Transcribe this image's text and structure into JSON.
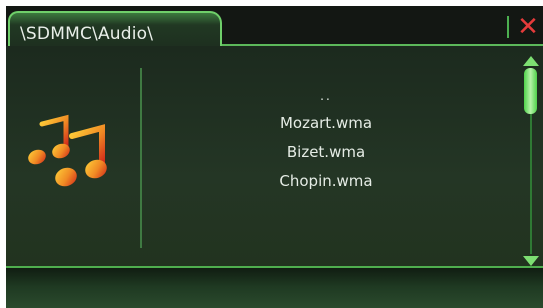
{
  "path_tab": {
    "label": "\\SDMMC\\Audio\\"
  },
  "close_button": {
    "label": "✕"
  },
  "music_icon": "music-notes-icon",
  "files": [
    {
      "name": ".."
    },
    {
      "name": "Mozart.wma"
    },
    {
      "name": "Bizet.wma"
    },
    {
      "name": "Chopin.wma"
    }
  ],
  "colors": {
    "accent_green": "#5cb85a",
    "close_red": "#e53b3b",
    "icon_orange": "#f08a24"
  }
}
